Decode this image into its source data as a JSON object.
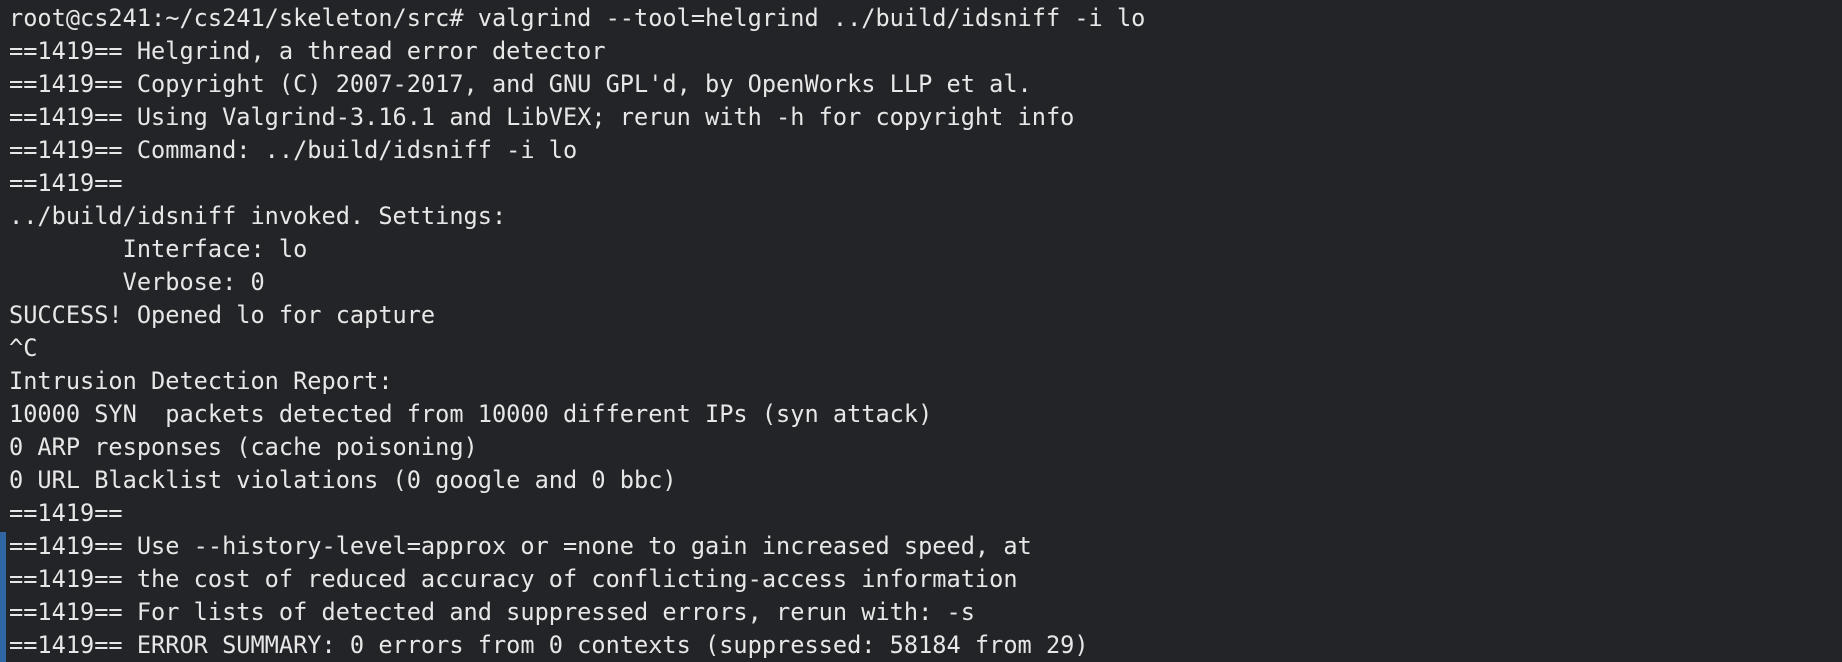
{
  "terminal": {
    "lines": [
      "root@cs241:~/cs241/skeleton/src# valgrind --tool=helgrind ../build/idsniff -i lo",
      "==1419== Helgrind, a thread error detector",
      "==1419== Copyright (C) 2007-2017, and GNU GPL'd, by OpenWorks LLP et al.",
      "==1419== Using Valgrind-3.16.1 and LibVEX; rerun with -h for copyright info",
      "==1419== Command: ../build/idsniff -i lo",
      "==1419==",
      "../build/idsniff invoked. Settings:",
      "        Interface: lo",
      "        Verbose: 0",
      "SUCCESS! Opened lo for capture",
      "^C",
      "Intrusion Detection Report:",
      "10000 SYN  packets detected from 10000 different IPs (syn attack)",
      "0 ARP responses (cache poisoning)",
      "0 URL Blacklist violations (0 google and 0 bbc)",
      "==1419==",
      "==1419== Use --history-level=approx or =none to gain increased speed, at",
      "==1419== the cost of reduced accuracy of conflicting-access information",
      "==1419== For lists of detected and suppressed errors, rerun with: -s",
      "==1419== ERROR SUMMARY: 0 errors from 0 contexts (suppressed: 58184 from 29)"
    ]
  },
  "colors": {
    "background": "#232427",
    "text": "#e7e7e7",
    "marker": "#2f66a3"
  }
}
